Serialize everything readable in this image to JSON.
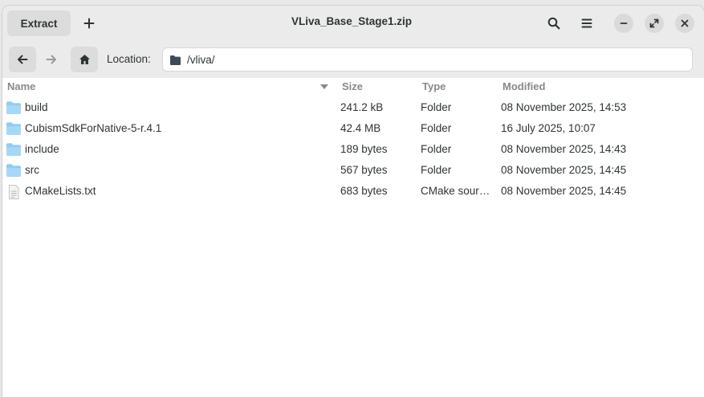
{
  "header": {
    "extract_label": "Extract",
    "add_icon": "plus-icon",
    "title": "VLiva_Base_Stage1.zip",
    "search_icon": "search-icon",
    "menu_icon": "hamburger-menu-icon",
    "window_controls": [
      "minimize-icon",
      "maximize-icon",
      "close-icon"
    ]
  },
  "navbar": {
    "back_icon": "arrow-left-icon",
    "forward_icon": "arrow-right-icon",
    "home_icon": "home-icon",
    "location_label": "Location:",
    "location_value": "/vliva/"
  },
  "columns": {
    "name": "Name",
    "size": "Size",
    "type": "Type",
    "modified": "Modified"
  },
  "files": [
    {
      "icon": "folder-icon",
      "name": "build",
      "size": "241.2 kB",
      "type": "Folder",
      "modified": "08 November 2025, 14:53"
    },
    {
      "icon": "folder-icon",
      "name": "CubismSdkForNative-5-r.4.1",
      "size": "42.4 MB",
      "type": "Folder",
      "modified": "16 July 2025, 10:07"
    },
    {
      "icon": "folder-icon",
      "name": "include",
      "size": "189 bytes",
      "type": "Folder",
      "modified": "08 November 2025, 14:43"
    },
    {
      "icon": "folder-icon",
      "name": "src",
      "size": "567 bytes",
      "type": "Folder",
      "modified": "08 November 2025, 14:45"
    },
    {
      "icon": "text-file-icon",
      "name": "CMakeLists.txt",
      "size": "683 bytes",
      "type": "CMake sour…",
      "modified": "08 November 2025, 14:45"
    }
  ],
  "colors": {
    "headerbar": "#ebebeb",
    "folder": "#8fcdf3",
    "text": "#2e3436",
    "column_header": "#888a85"
  }
}
